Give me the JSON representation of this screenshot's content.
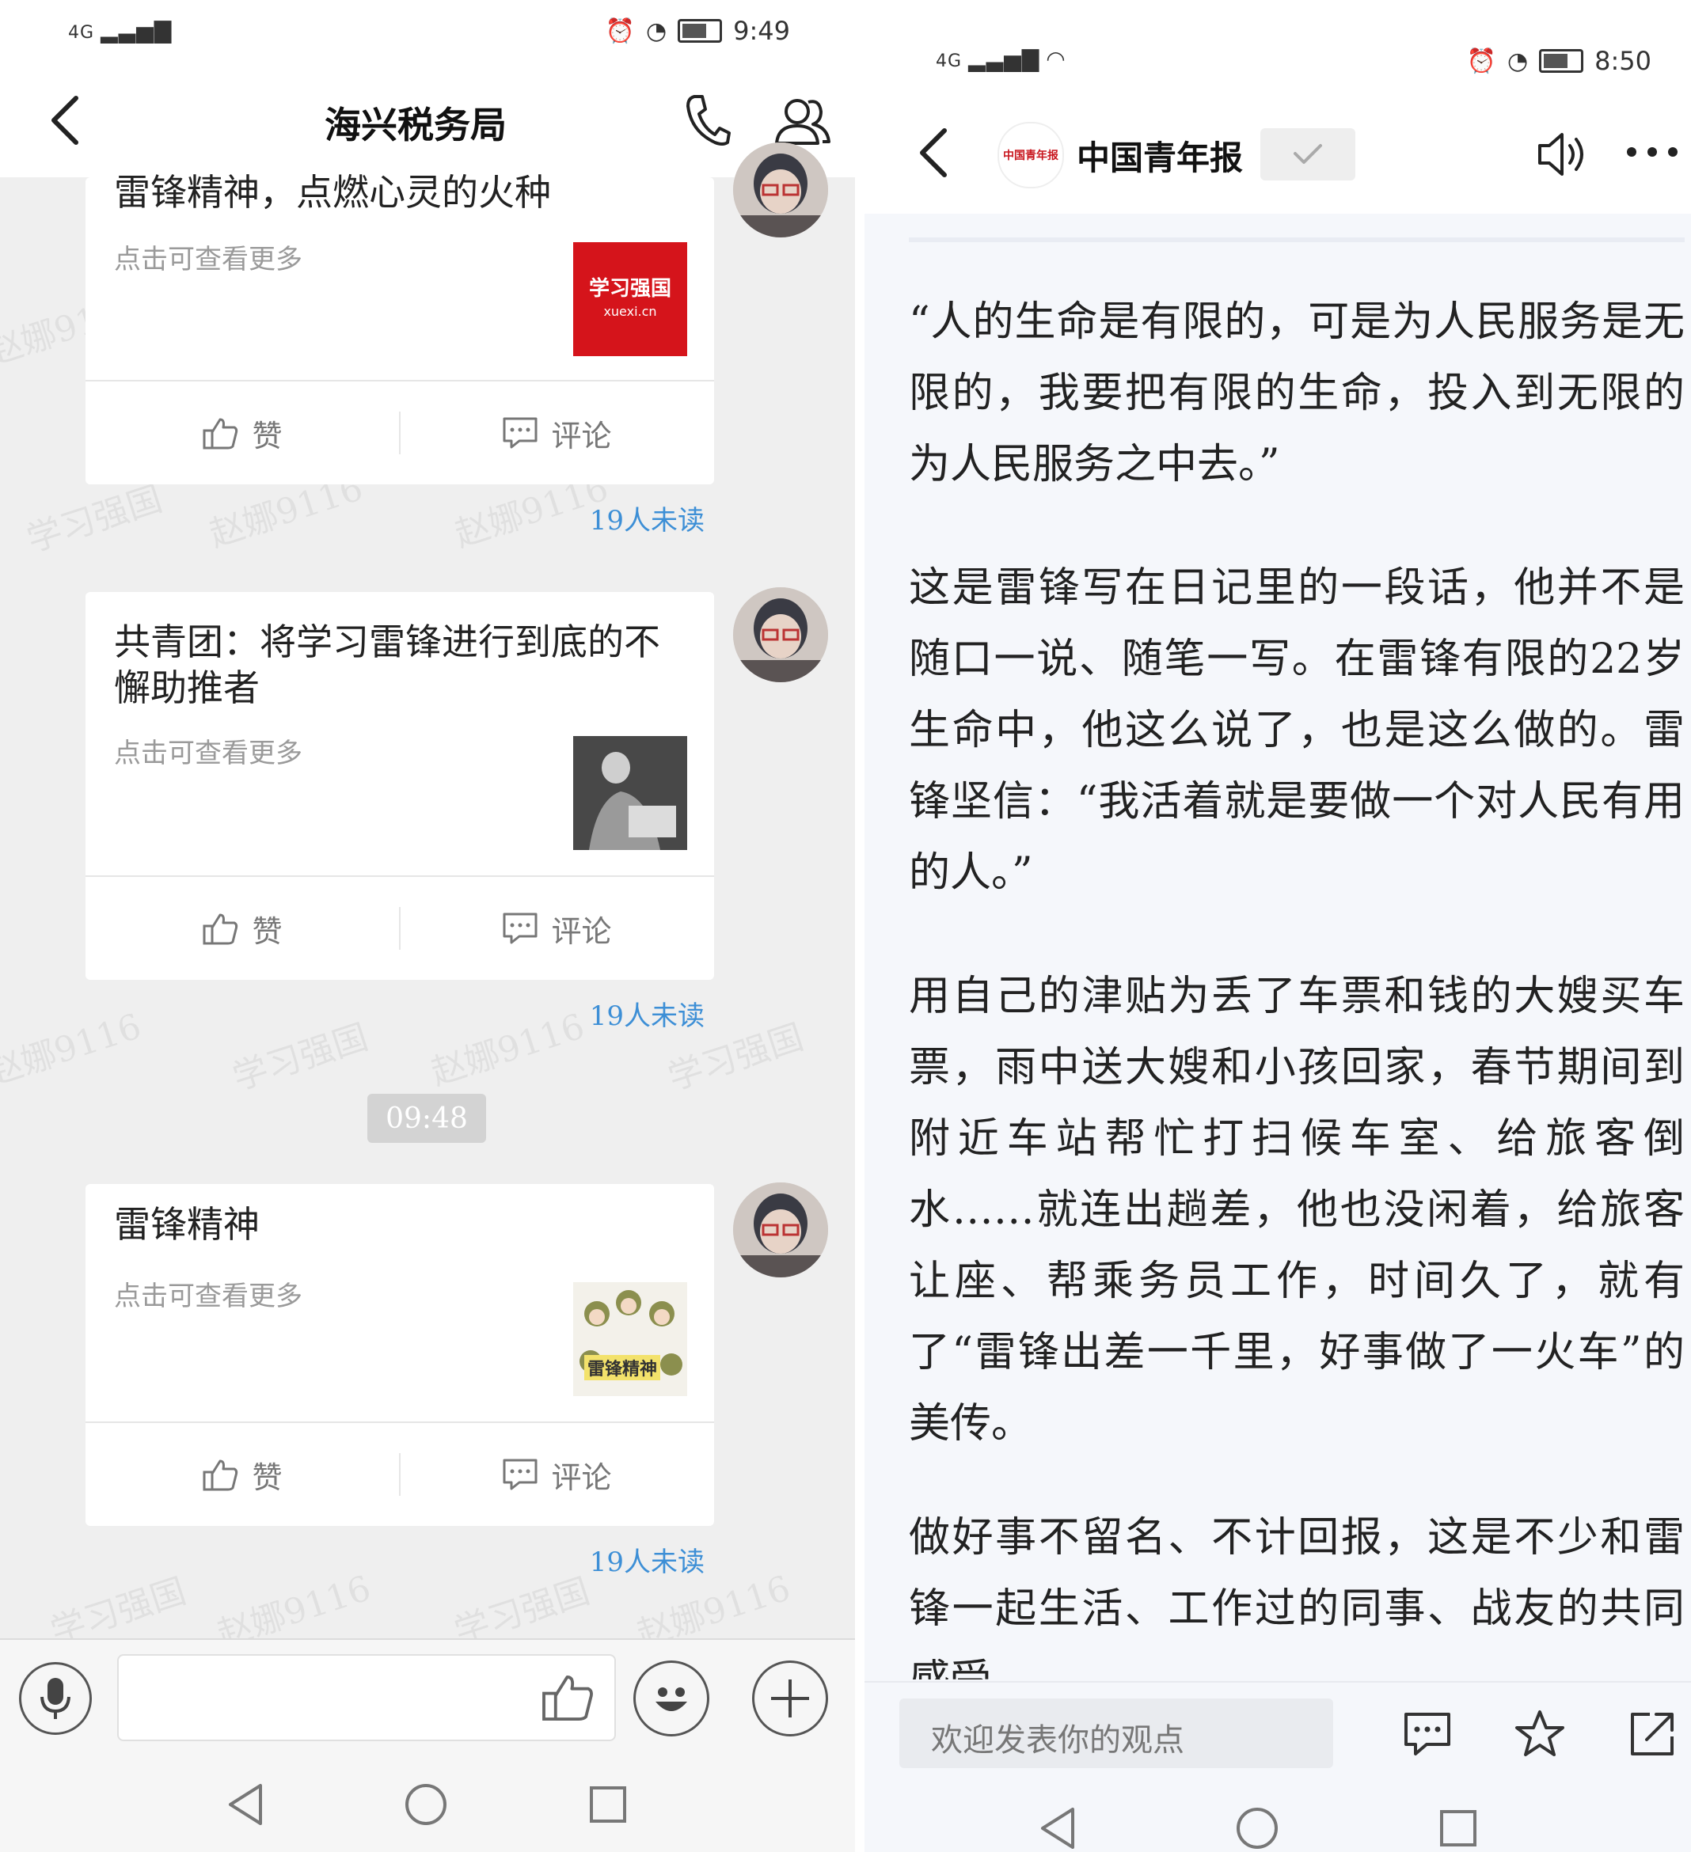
{
  "left": {
    "status": {
      "network": "4G",
      "time": "9:49"
    },
    "header": {
      "title": "海兴税务局"
    },
    "messages": [
      {
        "title": "雷锋精神，点燃心灵的火种",
        "subtitle": "点击可查看更多",
        "thumb_text": "学习强国",
        "thumb_sub": "xuexi.cn",
        "like": "赞",
        "comment": "评论",
        "unread": "19人未读"
      },
      {
        "title": "共青团：将学习雷锋进行到底的不懈助推者",
        "subtitle": "点击可查看更多",
        "like": "赞",
        "comment": "评论",
        "unread": "19人未读"
      },
      {
        "title": "雷锋精神",
        "subtitle": "点击可查看更多",
        "thumb_text": "雷锋精神",
        "like": "赞",
        "comment": "评论",
        "unread": "19人未读"
      }
    ],
    "time_divider": "09:48",
    "watermarks": [
      "赵娜9116",
      "学习强国"
    ]
  },
  "right": {
    "status": {
      "network": "4G",
      "time": "8:50"
    },
    "header": {
      "source": "中国青年报",
      "logo_text": "中国青年报"
    },
    "paragraphs": [
      "“人的生命是有限的，可是为人民服务是无限的，我要把有限的生命，投入到无限的为人民服务之中去。”",
      "这是雷锋写在日记里的一段话，他并不是随口一说、随笔一写。在雷锋有限的22岁生命中，他这么说了，也是这么做的。雷锋坚信：“我活着就是要做一个对人民有用的人。”",
      "用自己的津贴为丢了车票和钱的大嫂买车票，雨中送大嫂和小孩回家，春节期间到附近车站帮忙打扫候车室、给旅客倒水……就连出趟差，他也没闲着，给旅客让座、帮乘务员工作，时间久了，就有了“雷锋出差一千里，好事做了一火车”的美传。",
      "做好事不留名、不计回报，这是不少和雷锋一起生活、工作过的同事、战友的共同感受。"
    ],
    "comment_placeholder": "欢迎发表你的观点"
  }
}
